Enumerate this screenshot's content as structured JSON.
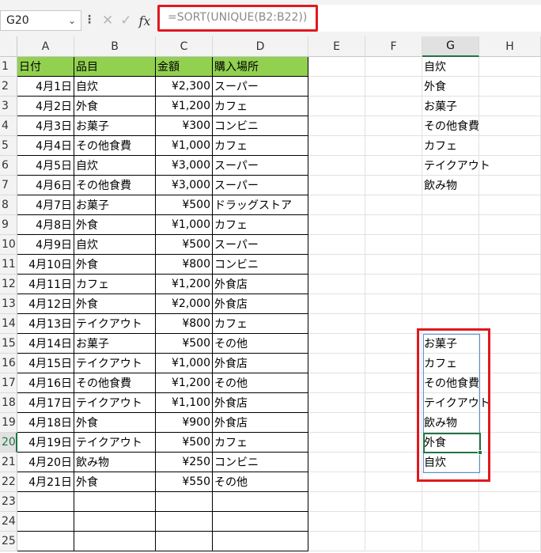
{
  "formula_bar": {
    "name_box": "G20",
    "formula": "=SORT(UNIQUE(B2:B22))",
    "fx_label": "fx"
  },
  "columns": [
    "A",
    "B",
    "C",
    "D",
    "E",
    "F",
    "G",
    "H"
  ],
  "selected_column": "G",
  "selected_row": 20,
  "rows": [
    "1",
    "2",
    "3",
    "4",
    "5",
    "6",
    "7",
    "8",
    "9",
    "10",
    "11",
    "12",
    "13",
    "14",
    "15",
    "16",
    "17",
    "18",
    "19",
    "20",
    "21",
    "22",
    "23",
    "24",
    "25"
  ],
  "table": {
    "headers": [
      "日付",
      "品目",
      "金額",
      "購入場所"
    ],
    "records": [
      [
        "4月1日",
        "自炊",
        "¥2,300",
        "スーパー"
      ],
      [
        "4月2日",
        "外食",
        "¥1,200",
        "カフェ"
      ],
      [
        "4月3日",
        "お菓子",
        "¥300",
        "コンビニ"
      ],
      [
        "4月4日",
        "その他食費",
        "¥1,000",
        "カフェ"
      ],
      [
        "4月5日",
        "自炊",
        "¥3,000",
        "スーパー"
      ],
      [
        "4月6日",
        "その他食費",
        "¥3,000",
        "スーパー"
      ],
      [
        "4月7日",
        "お菓子",
        "¥500",
        "ドラッグストア"
      ],
      [
        "4月8日",
        "外食",
        "¥1,000",
        "カフェ"
      ],
      [
        "4月9日",
        "自炊",
        "¥500",
        "スーパー"
      ],
      [
        "4月10日",
        "外食",
        "¥800",
        "コンビニ"
      ],
      [
        "4月11日",
        "カフェ",
        "¥1,200",
        "外食店"
      ],
      [
        "4月12日",
        "外食",
        "¥2,000",
        "外食店"
      ],
      [
        "4月13日",
        "テイクアウト",
        "¥800",
        "カフェ"
      ],
      [
        "4月14日",
        "お菓子",
        "¥500",
        "その他"
      ],
      [
        "4月15日",
        "テイクアウト",
        "¥1,000",
        "外食店"
      ],
      [
        "4月16日",
        "その他食費",
        "¥1,200",
        "その他"
      ],
      [
        "4月17日",
        "テイクアウト",
        "¥1,100",
        "外食店"
      ],
      [
        "4月18日",
        "外食",
        "¥900",
        "外食店"
      ],
      [
        "4月19日",
        "テイクアウト",
        "¥500",
        "カフェ"
      ],
      [
        "4月20日",
        "飲み物",
        "¥250",
        "コンビニ"
      ],
      [
        "4月21日",
        "外食",
        "¥550",
        "その他"
      ]
    ]
  },
  "unique_list": [
    "自炊",
    "外食",
    "お菓子",
    "その他食費",
    "カフェ",
    "テイクアウト",
    "飲み物"
  ],
  "sorted_list": [
    "お菓子",
    "カフェ",
    "その他食費",
    "テイクアウト",
    "飲み物",
    "外食",
    "自炊"
  ],
  "colors": {
    "header_fill": "#92d050",
    "highlight_red": "#e0191f",
    "selection_green": "#217346"
  }
}
